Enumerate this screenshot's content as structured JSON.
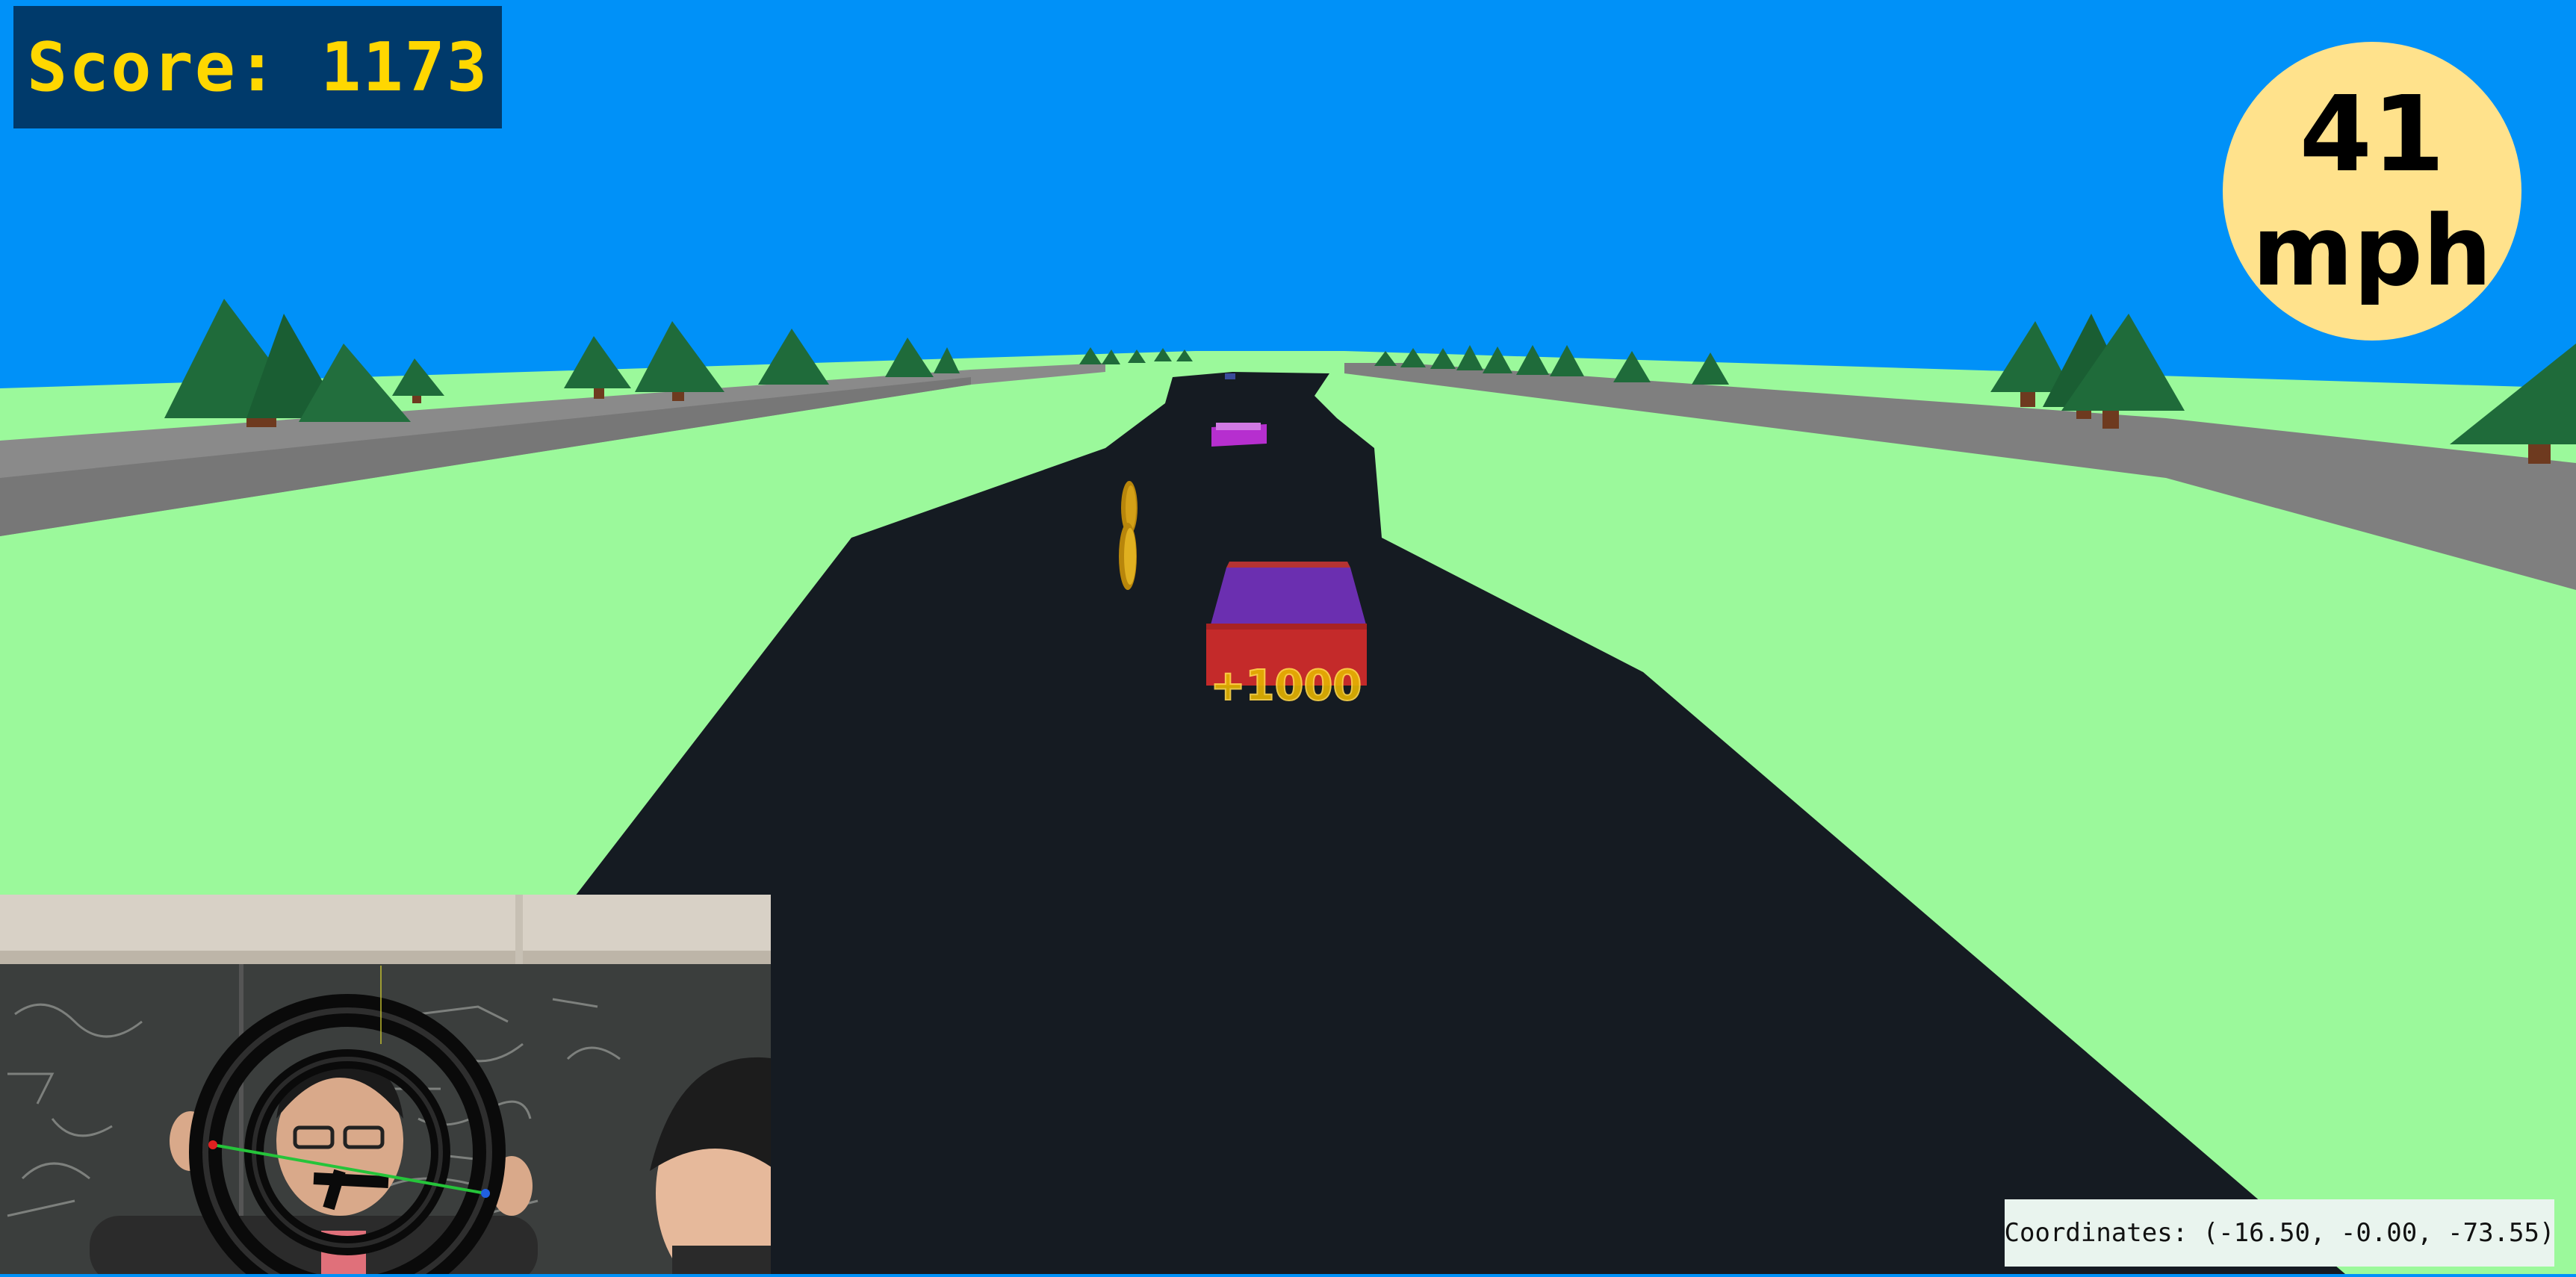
{
  "hud": {
    "score_label": "Score: 1173",
    "speed_value": "41",
    "speed_unit": "mph",
    "coordinates_label": "Coordinates: (-16.50, -0.00, -73.55)"
  },
  "scene": {
    "coin_popup_text": "+1000"
  },
  "colors": {
    "sky": "#0091f8",
    "grass": "#9bf99b",
    "road": "#151b22",
    "guardrail": "#7a7a7a",
    "score_bg": "#003a6b",
    "score_text": "#ffd700",
    "speedometer": "#ffe28c",
    "player_car_body": "#c42a2a",
    "player_car_roof": "#6b2fb0",
    "other_car": "#b62fcf",
    "coin": "#d4a017",
    "tree": "#1f6b3a",
    "trunk": "#6e3a1f"
  },
  "icons": [
    "steering-wheel-icon"
  ]
}
